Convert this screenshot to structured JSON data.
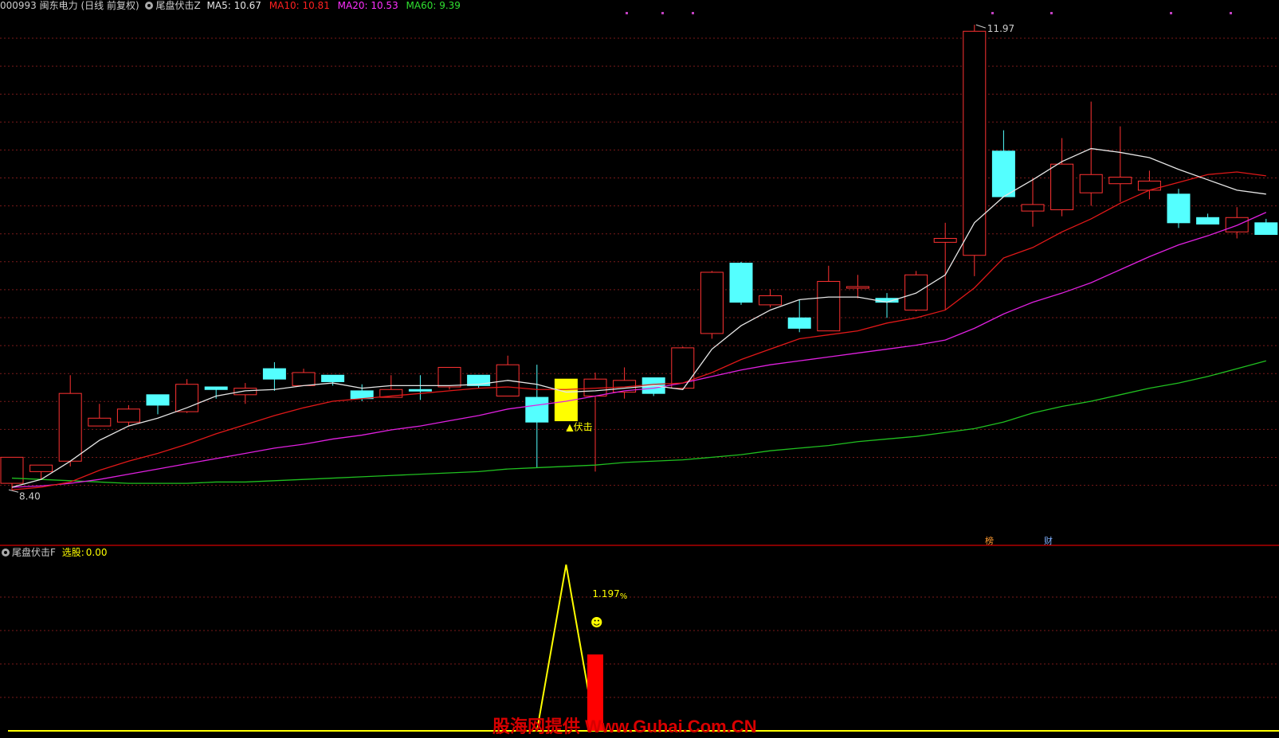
{
  "header": {
    "stock": "000993 闽东电力",
    "period": "(日线 前复权)",
    "indicator": "尾盘伏击Z",
    "ma5": "MA5: 10.67",
    "ma10": "MA10: 10.81",
    "ma20": "MA20: 10.53",
    "ma60": "MA60: 9.39"
  },
  "colors": {
    "up": "#ff3232",
    "down": "#54ffff",
    "signal": "#ffff00",
    "ma5": "#e6e6e6",
    "ma10": "#e01818",
    "ma20": "#e020e0",
    "ma60": "#20c020",
    "grid": "#7a1a1a",
    "divider": "#b00000",
    "sub_line": "#ffff00",
    "sub_bar": "#ff0000"
  },
  "price_labels": {
    "high": "11.97",
    "low": "8.40"
  },
  "signal_label": "▲伏击",
  "markers": {
    "bang": "榜",
    "cai": "财"
  },
  "sub_header": {
    "indicator": "尾盘伏击F",
    "label": "选股:",
    "value": "0.00"
  },
  "sub_annotation": {
    "percent": "1.197",
    "pct_sign": "%",
    "smile": "☻"
  },
  "watermark": "股海网提供 Www.Guhai.Com.CN",
  "chart_data": {
    "type": "candlestick",
    "ylim": [
      8.2,
      12.05
    ],
    "candles": [
      {
        "o": 8.65,
        "h": 8.65,
        "l": 8.4,
        "c": 8.45,
        "type": "up"
      },
      {
        "o": 8.54,
        "h": 8.58,
        "l": 8.48,
        "c": 8.59,
        "type": "up"
      },
      {
        "o": 8.62,
        "h": 9.28,
        "l": 8.58,
        "c": 9.14,
        "type": "up"
      },
      {
        "o": 8.89,
        "h": 9.06,
        "l": 8.89,
        "c": 8.95,
        "type": "up"
      },
      {
        "o": 8.92,
        "h": 9.05,
        "l": 8.89,
        "c": 9.02,
        "type": "up"
      },
      {
        "o": 9.13,
        "h": 9.13,
        "l": 8.98,
        "c": 9.05,
        "type": "down"
      },
      {
        "o": 9.0,
        "h": 9.25,
        "l": 8.99,
        "c": 9.21,
        "type": "up"
      },
      {
        "o": 9.19,
        "h": 9.19,
        "l": 9.1,
        "c": 9.17,
        "type": "down"
      },
      {
        "o": 9.13,
        "h": 9.22,
        "l": 9.06,
        "c": 9.18,
        "type": "up"
      },
      {
        "o": 9.33,
        "h": 9.38,
        "l": 9.16,
        "c": 9.25,
        "type": "down"
      },
      {
        "o": 9.2,
        "h": 9.33,
        "l": 9.2,
        "c": 9.3,
        "type": "up"
      },
      {
        "o": 9.28,
        "h": 9.28,
        "l": 9.2,
        "c": 9.23,
        "type": "down"
      },
      {
        "o": 9.16,
        "h": 9.21,
        "l": 9.08,
        "c": 9.1,
        "type": "down"
      },
      {
        "o": 9.11,
        "h": 9.28,
        "l": 9.11,
        "c": 9.17,
        "type": "up"
      },
      {
        "o": 9.17,
        "h": 9.28,
        "l": 9.09,
        "c": 9.17,
        "type": "down"
      },
      {
        "o": 9.19,
        "h": 9.34,
        "l": 9.17,
        "c": 9.34,
        "type": "up"
      },
      {
        "o": 9.28,
        "h": 9.28,
        "l": 9.18,
        "c": 9.2,
        "type": "down"
      },
      {
        "o": 9.12,
        "h": 9.43,
        "l": 9.12,
        "c": 9.36,
        "type": "up"
      },
      {
        "o": 9.11,
        "h": 9.36,
        "l": 8.57,
        "c": 8.92,
        "type": "down"
      },
      {
        "o": 8.93,
        "h": 9.25,
        "l": 8.93,
        "c": 9.25,
        "type": "signal"
      },
      {
        "o": 9.12,
        "h": 9.3,
        "l": 8.54,
        "c": 9.25,
        "type": "up"
      },
      {
        "o": 9.15,
        "h": 9.34,
        "l": 9.1,
        "c": 9.24,
        "type": "up"
      },
      {
        "o": 9.26,
        "h": 9.25,
        "l": 9.12,
        "c": 9.14,
        "type": "down"
      },
      {
        "o": 9.18,
        "h": 9.5,
        "l": 9.17,
        "c": 9.49,
        "type": "up"
      },
      {
        "o": 9.6,
        "h": 10.08,
        "l": 9.56,
        "c": 10.07,
        "type": "up"
      },
      {
        "o": 10.14,
        "h": 10.15,
        "l": 9.82,
        "c": 9.84,
        "type": "down"
      },
      {
        "o": 9.82,
        "h": 9.94,
        "l": 9.8,
        "c": 9.89,
        "type": "up"
      },
      {
        "o": 9.72,
        "h": 9.86,
        "l": 9.61,
        "c": 9.64,
        "type": "down"
      },
      {
        "o": 9.62,
        "h": 10.12,
        "l": 9.62,
        "c": 10.0,
        "type": "up"
      },
      {
        "o": 9.96,
        "h": 10.05,
        "l": 9.87,
        "c": 9.96,
        "type": "up"
      },
      {
        "o": 9.87,
        "h": 9.91,
        "l": 9.72,
        "c": 9.84,
        "type": "down"
      },
      {
        "o": 9.78,
        "h": 10.08,
        "l": 9.77,
        "c": 10.05,
        "type": "up"
      },
      {
        "o": 10.33,
        "h": 10.45,
        "l": 9.78,
        "c": 10.3,
        "type": "up"
      },
      {
        "o": 10.2,
        "h": 11.97,
        "l": 10.04,
        "c": 11.92,
        "type": "up"
      },
      {
        "o": 11.0,
        "h": 11.16,
        "l": 10.83,
        "c": 10.65,
        "type": "down"
      },
      {
        "o": 10.54,
        "h": 10.79,
        "l": 10.42,
        "c": 10.59,
        "type": "up"
      },
      {
        "o": 10.55,
        "h": 11.1,
        "l": 10.5,
        "c": 10.9,
        "type": "up"
      },
      {
        "o": 10.68,
        "h": 11.38,
        "l": 10.58,
        "c": 10.82,
        "type": "up"
      },
      {
        "o": 10.75,
        "h": 11.19,
        "l": 10.61,
        "c": 10.8,
        "type": "up"
      },
      {
        "o": 10.7,
        "h": 10.85,
        "l": 10.63,
        "c": 10.77,
        "type": "up"
      },
      {
        "o": 10.67,
        "h": 10.71,
        "l": 10.41,
        "c": 10.45,
        "type": "down"
      },
      {
        "o": 10.49,
        "h": 10.52,
        "l": 10.48,
        "c": 10.44,
        "type": "down"
      },
      {
        "o": 10.38,
        "h": 10.57,
        "l": 10.33,
        "c": 10.49,
        "type": "up"
      },
      {
        "o": 10.45,
        "h": 10.48,
        "l": 10.41,
        "c": 10.36,
        "type": "down"
      }
    ],
    "ma5": [
      8.42,
      8.48,
      8.62,
      8.78,
      8.89,
      8.95,
      9.03,
      9.12,
      9.16,
      9.17,
      9.2,
      9.22,
      9.18,
      9.2,
      9.2,
      9.2,
      9.21,
      9.24,
      9.21,
      9.15,
      9.16,
      9.18,
      9.2,
      9.17,
      9.48,
      9.66,
      9.78,
      9.86,
      9.88,
      9.88,
      9.84,
      9.91,
      10.05,
      10.45,
      10.65,
      10.78,
      10.92,
      11.02,
      10.99,
      10.95,
      10.86,
      10.78,
      10.7,
      10.67
    ],
    "ma10": [
      8.4,
      8.42,
      8.46,
      8.55,
      8.62,
      8.68,
      8.75,
      8.83,
      8.9,
      8.97,
      9.03,
      9.08,
      9.1,
      9.12,
      9.14,
      9.16,
      9.18,
      9.19,
      9.17,
      9.17,
      9.18,
      9.19,
      9.21,
      9.22,
      9.3,
      9.4,
      9.48,
      9.56,
      9.59,
      9.62,
      9.68,
      9.72,
      9.78,
      9.95,
      10.18,
      10.26,
      10.38,
      10.48,
      10.6,
      10.7,
      10.76,
      10.82,
      10.84,
      10.81
    ],
    "ma20": [
      8.42,
      8.43,
      8.45,
      8.48,
      8.52,
      8.56,
      8.6,
      8.64,
      8.68,
      8.72,
      8.75,
      8.79,
      8.82,
      8.86,
      8.89,
      8.93,
      8.97,
      9.02,
      9.05,
      9.08,
      9.12,
      9.16,
      9.18,
      9.22,
      9.27,
      9.32,
      9.36,
      9.39,
      9.42,
      9.45,
      9.48,
      9.51,
      9.55,
      9.64,
      9.75,
      9.84,
      9.91,
      9.99,
      10.09,
      10.19,
      10.28,
      10.35,
      10.43,
      10.53
    ],
    "ma60": [
      8.49,
      8.48,
      8.47,
      8.46,
      8.45,
      8.45,
      8.45,
      8.46,
      8.46,
      8.47,
      8.48,
      8.49,
      8.5,
      8.51,
      8.52,
      8.53,
      8.54,
      8.56,
      8.57,
      8.58,
      8.59,
      8.61,
      8.62,
      8.63,
      8.65,
      8.67,
      8.7,
      8.72,
      8.74,
      8.77,
      8.79,
      8.81,
      8.84,
      8.87,
      8.92,
      8.99,
      9.04,
      9.08,
      9.13,
      9.18,
      9.22,
      9.27,
      9.33,
      9.39
    ],
    "signal_index": 19,
    "sub": {
      "ylim": [
        0,
        1.25
      ],
      "line_peak_index": 19,
      "line_peak": 1.197,
      "bar_index": 20,
      "bar_value": 0.55
    }
  }
}
